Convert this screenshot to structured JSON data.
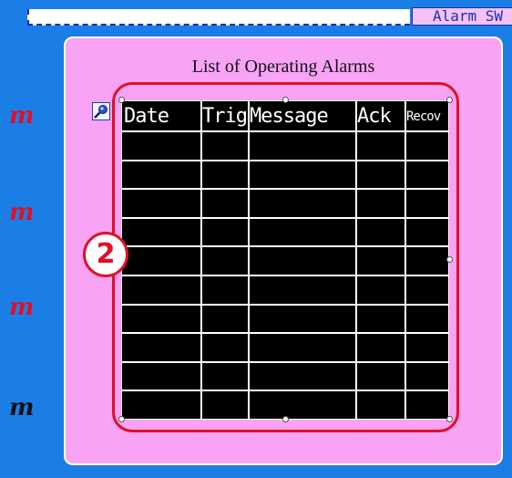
{
  "top_bar": {
    "alarm_sw_label": "Alarm SW"
  },
  "left_marks": [
    "m",
    "m",
    "m",
    "m"
  ],
  "left_mark_colors": [
    "#e0102a",
    "#e0102a",
    "#e0102a",
    "#111111"
  ],
  "panel": {
    "title": "List of Operating Alarms"
  },
  "table": {
    "columns": [
      "Date",
      "Trig",
      "Message",
      "Ack",
      "Recov"
    ],
    "row_count": 10
  },
  "callout": {
    "number": "2"
  },
  "colors": {
    "background": "#1a7ee6",
    "panel": "#f8a3f4",
    "highlight": "#e0102a",
    "table_bg": "#000000",
    "grid": "#ffffff"
  }
}
